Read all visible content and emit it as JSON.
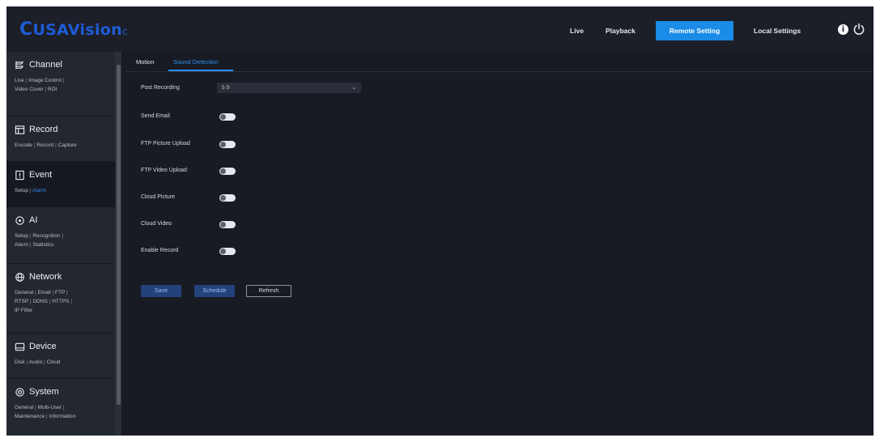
{
  "app": {
    "logo_c": "C",
    "logo_main": "USAVision",
    "logo_tail": "c"
  },
  "nav": {
    "live": "Live",
    "playback": "Playback",
    "remote_setting": "Remote Setting",
    "local_settings": "Local Settings",
    "info_glyph": "i",
    "active_color": "#1a8be6"
  },
  "sidebar": {
    "sections": [
      {
        "title": "Channel",
        "icon": "channel-icon",
        "links": [
          "Live",
          "Image Control",
          "Video Cover",
          "ROI"
        ]
      },
      {
        "title": "Record",
        "icon": "record-icon",
        "links": [
          "Encode",
          "Record",
          "Capture"
        ]
      },
      {
        "title": "Event",
        "icon": "event-icon",
        "active": true,
        "links": [
          "Setup",
          "Alarm"
        ],
        "highlighted_link": "Alarm"
      },
      {
        "title": "AI",
        "icon": "ai-icon",
        "links": [
          "Setup",
          "Recognition",
          "Alarm",
          "Statistics"
        ]
      },
      {
        "title": "Network",
        "icon": "network-icon",
        "links": [
          "General",
          "Email",
          "FTP",
          "RTSP",
          "DDNS",
          "HTTPS",
          "IP Filter"
        ]
      },
      {
        "title": "Device",
        "icon": "device-icon",
        "links": [
          "Disk",
          "Audio",
          "Cloud"
        ]
      },
      {
        "title": "System",
        "icon": "system-icon",
        "links": [
          "General",
          "Multi-User",
          "Maintenance",
          "Information"
        ]
      }
    ],
    "separator": "|",
    "highlight_color": "#2f8ff0"
  },
  "tabs": {
    "motion": "Motion",
    "sound_detection": "Sound Detection"
  },
  "form": {
    "post_recording_label": "Post Recording",
    "post_recording_value": "5 S",
    "send_email_label": "Send Email",
    "ftp_picture_upload_label": "FTP Picture Upload",
    "ftp_video_upload_label": "FTP Video Upload",
    "cloud_picture_label": "Cloud Picture",
    "cloud_video_label": "Cloud Video",
    "enable_record_label": "Enable Record",
    "toggles_on": [
      false,
      false,
      false,
      false,
      false,
      false
    ]
  },
  "buttons": {
    "save": "Save",
    "schedule": "Schedule",
    "refresh": "Refresh"
  }
}
